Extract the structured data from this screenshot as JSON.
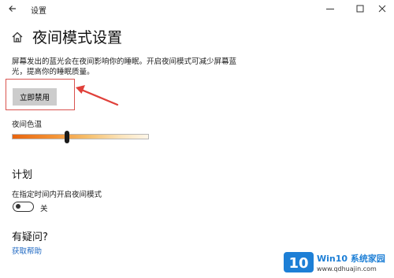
{
  "window": {
    "title": "设置"
  },
  "page": {
    "title": "夜间模式设置",
    "description": "屏幕发出的蓝光会在夜间影响你的睡眠。开启夜间模式可减少屏幕蓝光，提高你的睡眠质量。",
    "disable_button": "立即禁用"
  },
  "color_temp": {
    "label": "夜间色温",
    "level_fraction": 0.4
  },
  "schedule": {
    "heading": "计划",
    "label": "在指定时间内开启夜间模式",
    "toggle_state": "关",
    "toggle_on": false
  },
  "help": {
    "heading": "有疑问?",
    "link": "获取帮助"
  },
  "watermark": {
    "logo_text": "10",
    "brand": "Win10 系统家园",
    "url": "www.qdhuajin.com"
  },
  "colors": {
    "accent_link": "#1d67c2",
    "highlight_red": "#d9534f"
  },
  "icons": [
    "back-arrow-icon",
    "minimize-icon",
    "maximize-icon",
    "close-icon",
    "home-icon"
  ]
}
